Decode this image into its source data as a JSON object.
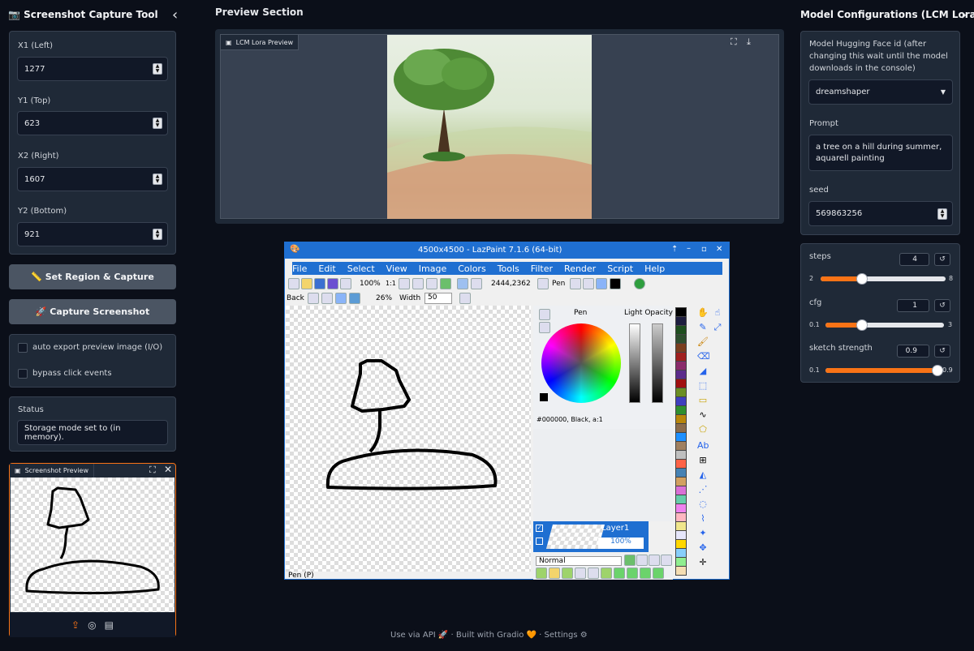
{
  "left": {
    "title": "Screenshot Capture Tool",
    "collapse_glyph": "‹",
    "fields": [
      {
        "label": "X1 (Left)",
        "value": "1277"
      },
      {
        "label": "Y1 (Top)",
        "value": "623"
      },
      {
        "label": "X2 (Right)",
        "value": "1607"
      },
      {
        "label": "Y2 (Bottom)",
        "value": "921"
      }
    ],
    "set_region_label": "📏 Set Region & Capture",
    "capture_label": "🚀 Capture Screenshot",
    "checks": [
      {
        "label": "auto export preview image (I/O)",
        "checked": false
      },
      {
        "label": "bypass click events",
        "checked": false
      }
    ],
    "status_label": "Status",
    "status_value": "Storage mode set to (in memory).",
    "preview_label": "Screenshot Preview"
  },
  "center": {
    "section_title": "Preview Section",
    "lcm_label": "LCM Lora Preview"
  },
  "lazpaint": {
    "window_title": "4500x4500 - LazPaint 7.1.6 (64-bit)",
    "menus": [
      "File",
      "Edit",
      "Select",
      "View",
      "Image",
      "Colors",
      "Tools",
      "Filter",
      "Render",
      "Script",
      "Help"
    ],
    "zoom": "100%",
    "zoom_ratio": "1:1",
    "coords": "2444,2362",
    "tool": "Pen",
    "back_label": "Back",
    "opacity": "26%",
    "width_label": "Width",
    "width_value": "50",
    "pen_label": "Pen",
    "light_opacity_label": "Light Opacity",
    "color_text": "#000000, Black, a:1",
    "layer_name": "Layer1",
    "layer_opacity": "100%",
    "blend_mode": "Normal",
    "status": "Pen (P)",
    "palette": [
      "#000000",
      "#1e1e3f",
      "#1f4f1f",
      "#2e4f2e",
      "#7a3e1f",
      "#a0201f",
      "#8b2b6b",
      "#5b2b8b",
      "#a01010",
      "#6b8e23",
      "#3f3fbf",
      "#2f8f2f",
      "#b8860b",
      "#8b6b4b",
      "#1e90ff",
      "#a08060",
      "#bfbfbf",
      "#ff6347",
      "#4682b4",
      "#d2a060",
      "#da70d6",
      "#66cdaa",
      "#ee82ee",
      "#ffb6c1",
      "#f0e68c",
      "#e6e6fa",
      "#ffd700",
      "#87cefa",
      "#90ee90",
      "#f5deb3"
    ]
  },
  "footer": {
    "api": "Use via API",
    "built": "Built with Gradio",
    "settings": "Settings"
  },
  "right": {
    "title": "Model Configurations (LCM Lora)",
    "model_label": "Model Hugging Face id (after changing this wait until the model downloads in the console)",
    "model_value": "dreamshaper",
    "prompt_label": "Prompt",
    "prompt_value": "a tree on a hill during summer, aquarell painting",
    "seed_label": "seed",
    "seed_value": "569863256",
    "sliders": [
      {
        "label": "steps",
        "value": "4",
        "min": "2",
        "max": "8",
        "fraction": 0.33
      },
      {
        "label": "cfg",
        "value": "1",
        "min": "0.1",
        "max": "3",
        "fraction": 0.31
      },
      {
        "label": "sketch strength",
        "value": "0.9",
        "min": "0.1",
        "max": "0.9",
        "fraction": 1.0
      }
    ]
  },
  "colors": {
    "accent": "#f97316",
    "panel": "#1f2937",
    "bg": "#0b0f19"
  }
}
